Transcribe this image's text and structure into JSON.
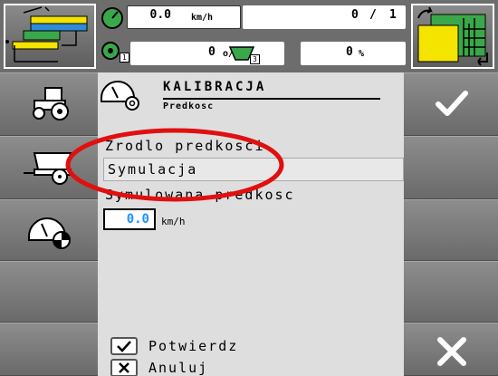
{
  "status_bar": {
    "speed_value": "0.0",
    "speed_unit": "km/h",
    "counter_current": "0",
    "counter_separator": "/",
    "counter_total": "1",
    "rpm_value": "0",
    "rpm_unit": "o/min",
    "tank_percent_value": "0",
    "tank_percent_unit": "%",
    "rpm_sensor_index": "1",
    "tank_index": "3"
  },
  "dialog": {
    "title": "KALIBRACJA",
    "subtitle": "Predkosc",
    "source_label": "Zrodlo predkosci",
    "source_value": "Symulacja",
    "sim_label": "Symulowana predkosc",
    "sim_value": "0.0",
    "sim_unit": "km/h",
    "confirm_label": "Potwierdz",
    "cancel_label": "Anuluj"
  },
  "icons": {
    "left_sidebar": [
      "tractor-icon",
      "trailer-icon",
      "speedometer-icon"
    ],
    "right_sidebar": [
      "check-icon",
      "cross-icon"
    ]
  },
  "colors": {
    "highlight_circle": "#e01010",
    "value_blue": "#1e90ff",
    "yellow": "#f4e400",
    "green": "#3aa84a"
  }
}
